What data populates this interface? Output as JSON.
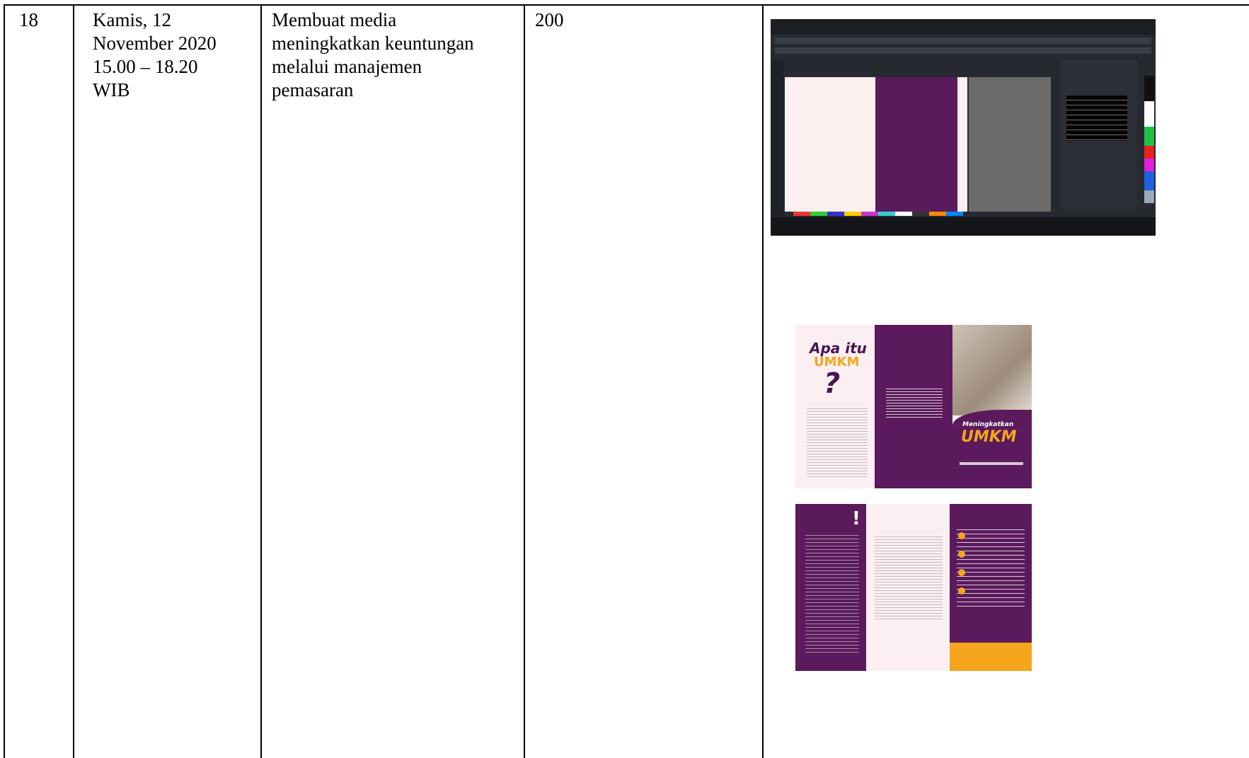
{
  "row": {
    "number": "18",
    "date": "Kamis, 12\nNovember 2020\n15.00 – 18.20\nWIB",
    "activity": "Membuat media\nmeningkatkan keuntungan\nmelalui manajemen\npemasaran",
    "duration": "200"
  },
  "brochure_front": {
    "apa_itu": "Apa itu",
    "umkm": "UMKM",
    "question_mark": "?",
    "meningkatkan": "Meningkatkan",
    "umkm_cover": "UMKM"
  },
  "brochure_back": {
    "exclamation": "!"
  },
  "colors": {
    "brand_purple": "#5b1a5c",
    "accent_orange": "#f4a51c",
    "background_pink": "#fbeff2"
  }
}
